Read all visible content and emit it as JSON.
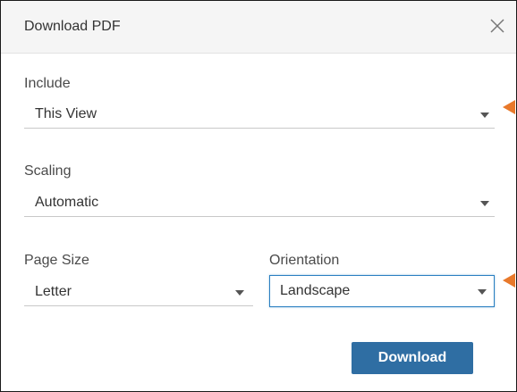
{
  "dialog": {
    "title": "Download PDF",
    "close_icon": "close-icon",
    "download_label": "Download"
  },
  "include": {
    "label": "Include",
    "value": "This View"
  },
  "scaling": {
    "label": "Scaling",
    "value": "Automatic"
  },
  "page_size": {
    "label": "Page Size",
    "value": "Letter"
  },
  "orientation": {
    "label": "Orientation",
    "value": "Landscape"
  },
  "colors": {
    "button": "#2f6ea3",
    "focus_border": "#2a7fc1",
    "annotation_arrow": "#e8792b"
  }
}
